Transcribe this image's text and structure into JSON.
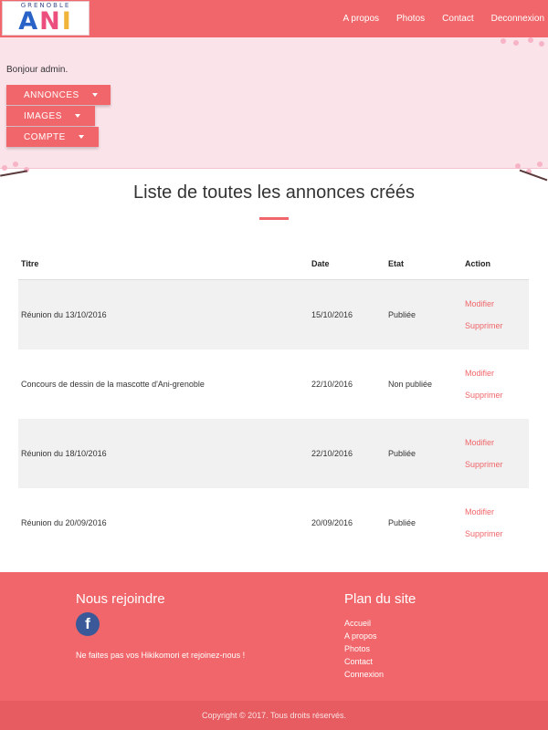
{
  "header": {
    "logo_top": "GRENOBLE",
    "logo_letters": [
      "A",
      "N",
      "I"
    ],
    "nav": [
      {
        "label": "A propos"
      },
      {
        "label": "Photos"
      },
      {
        "label": "Contact"
      },
      {
        "label": "Deconnexion"
      }
    ]
  },
  "admin": {
    "greeting": "Bonjour admin.",
    "dropdowns": [
      {
        "label": "ANNONCES"
      },
      {
        "label": "IMAGES"
      },
      {
        "label": "COMPTE"
      }
    ]
  },
  "main": {
    "title": "Liste de toutes les annonces créés",
    "table": {
      "headers": [
        "Titre",
        "Date",
        "Etat",
        "Action"
      ],
      "rows": [
        {
          "titre": "Réunion du 13/10/2016",
          "date": "15/10/2016",
          "etat": "Publiée",
          "modifier": "Modifier",
          "supprimer": "Supprimer"
        },
        {
          "titre": "Concours de dessin de la mascotte d'Ani-grenoble",
          "date": "22/10/2016",
          "etat": "Non publiée",
          "modifier": "Modifier",
          "supprimer": "Supprimer"
        },
        {
          "titre": "Réunion du 18/10/2016",
          "date": "22/10/2016",
          "etat": "Publiée",
          "modifier": "Modifier",
          "supprimer": "Supprimer"
        },
        {
          "titre": "Réunion du 20/09/2016",
          "date": "20/09/2016",
          "etat": "Publiée",
          "modifier": "Modifier",
          "supprimer": "Supprimer"
        }
      ]
    }
  },
  "footer": {
    "join_title": "Nous rejoindre",
    "facebook_icon": "f",
    "join_text": "Ne faites pas vos Hikikomori et rejoinez-nous !",
    "sitemap_title": "Plan du site",
    "sitemap": [
      {
        "label": "Accueil"
      },
      {
        "label": "A propos"
      },
      {
        "label": "Photos"
      },
      {
        "label": "Contact"
      },
      {
        "label": "Connexion"
      }
    ],
    "copyright": "Copyright © 2017. Tous droits réservés."
  },
  "colors": {
    "accent": "#f0666a",
    "banner": "#fbe3ea",
    "row_alt": "#f1f1f1",
    "facebook": "#3b5998"
  }
}
